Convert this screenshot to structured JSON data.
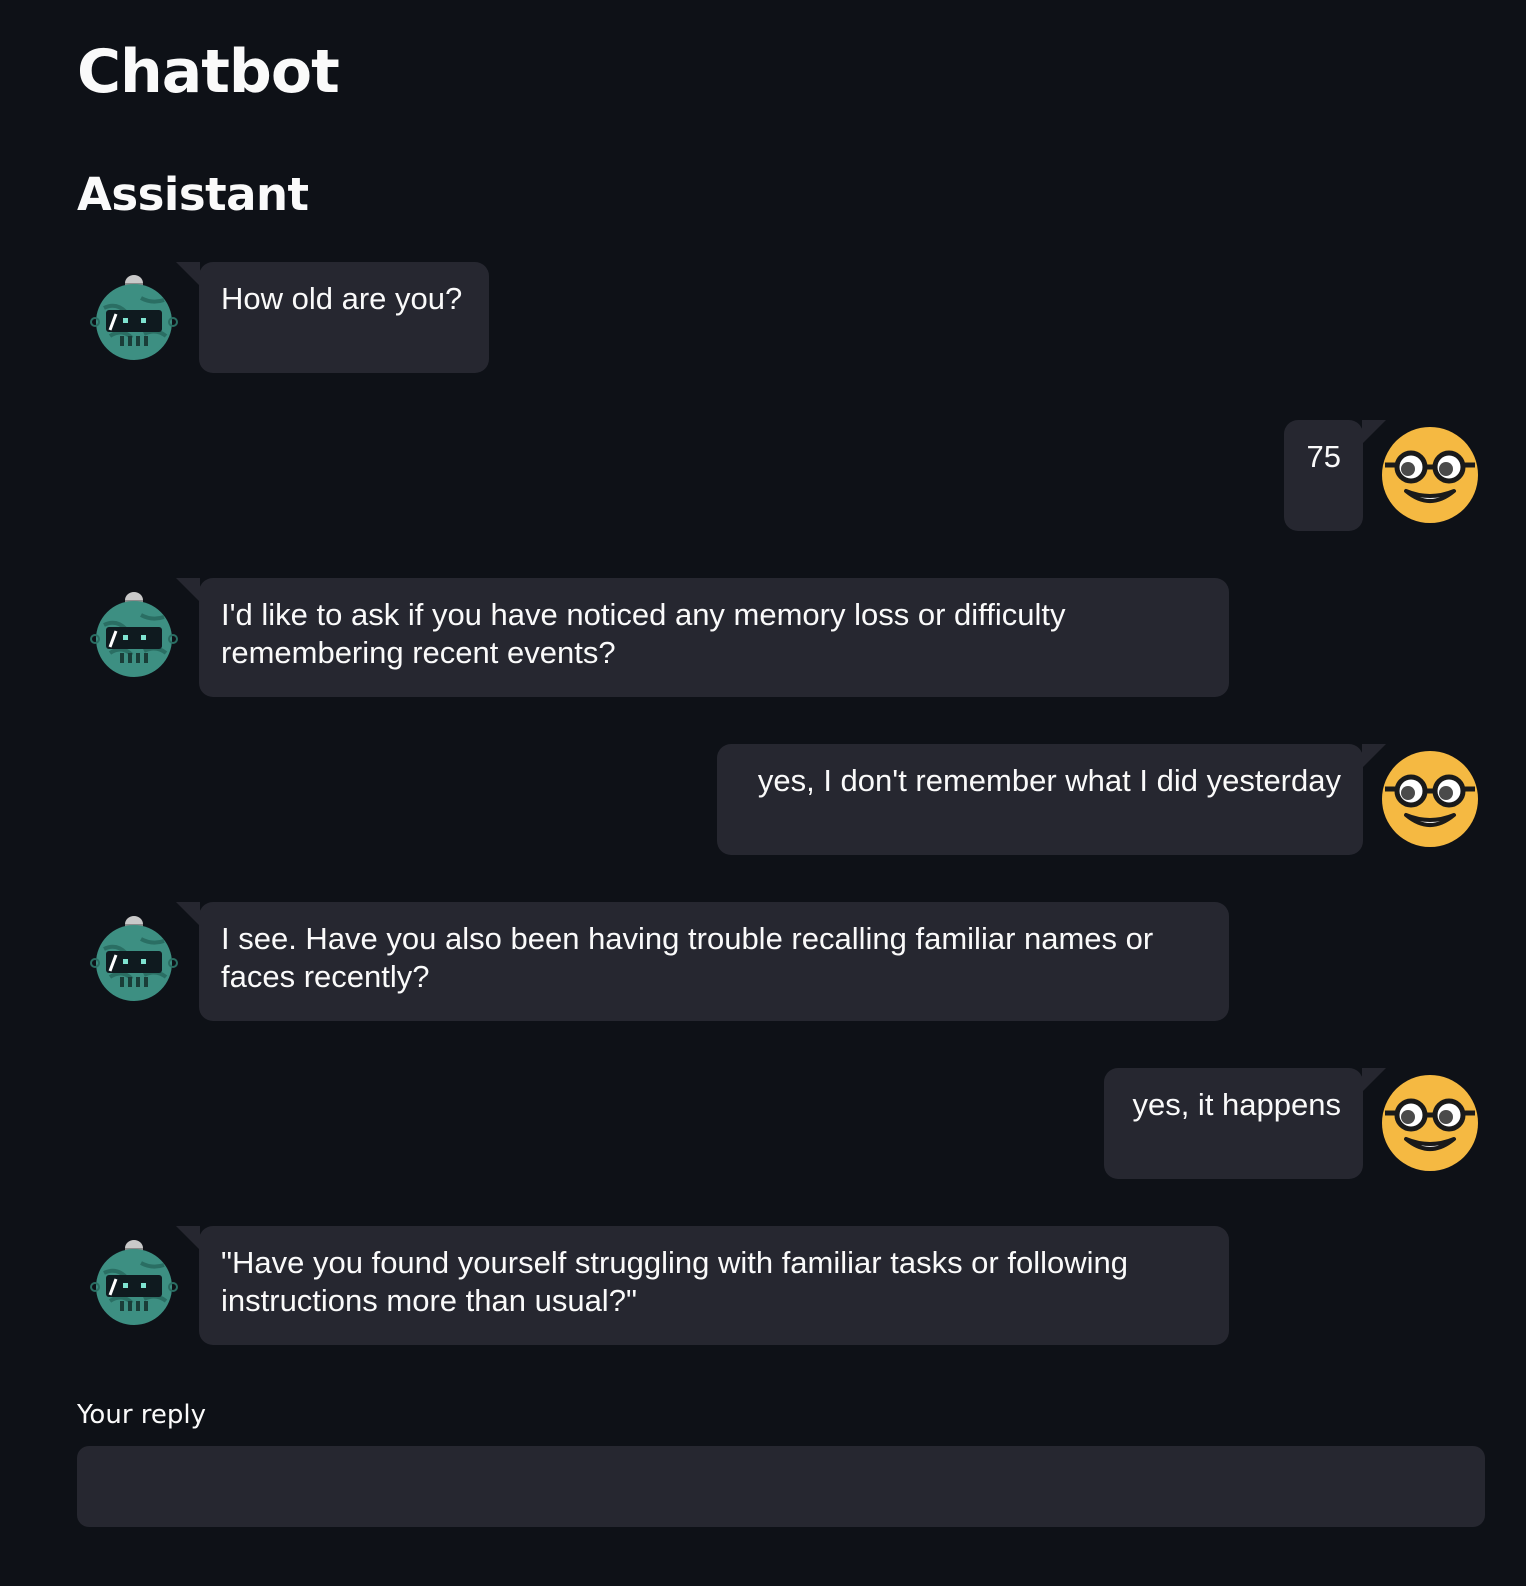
{
  "app": {
    "title": "Chatbot",
    "section_title": "Assistant"
  },
  "colors": {
    "background": "#0e1117",
    "bubble": "#262730",
    "text": "#fafafa",
    "user_avatar": "#f5b942",
    "bot_avatar": "#3d8f82"
  },
  "messages": [
    {
      "role": "assistant",
      "avatar": "robot-icon",
      "text": "How old are you?"
    },
    {
      "role": "user",
      "avatar": "nerd-face-icon",
      "text": "75"
    },
    {
      "role": "assistant",
      "avatar": "robot-icon",
      "text": "I'd like to ask if you have noticed any memory loss or difficulty remembering recent events?"
    },
    {
      "role": "user",
      "avatar": "nerd-face-icon",
      "text": "yes, I don't remember what I did yesterday"
    },
    {
      "role": "assistant",
      "avatar": "robot-icon",
      "text": "I see. Have you also been having trouble recalling familiar names or faces recently?"
    },
    {
      "role": "user",
      "avatar": "nerd-face-icon",
      "text": "yes, it happens"
    },
    {
      "role": "assistant",
      "avatar": "robot-icon",
      "text": "\"Have you found yourself struggling with familiar tasks or following instructions more than usual?\""
    }
  ],
  "reply": {
    "label": "Your reply",
    "value": "",
    "placeholder": ""
  }
}
